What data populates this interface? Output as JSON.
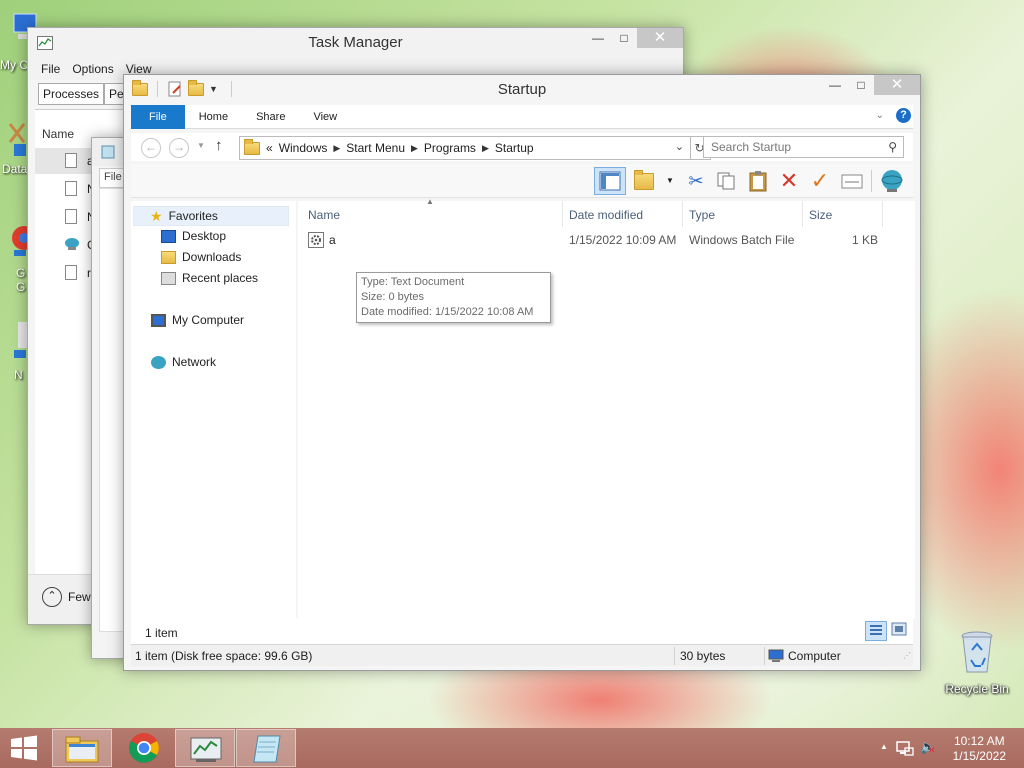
{
  "desktop": {
    "icons": [
      {
        "label": "My C",
        "name": "my-computer"
      },
      {
        "label": "Data",
        "name": "data"
      },
      {
        "label": "G\nG",
        "name": "google-chrome"
      },
      {
        "label": "N",
        "name": "network"
      },
      {
        "label": "Recycle Bin",
        "name": "recycle-bin"
      }
    ]
  },
  "taskmanager": {
    "title": "Task Manager",
    "menu": [
      "File",
      "Options",
      "View"
    ],
    "tabs": [
      "Processes",
      "Per"
    ],
    "column": "Name",
    "rows": [
      "a",
      "N",
      "N",
      "C",
      "r"
    ],
    "fewer_details": "Few"
  },
  "midwin": {
    "menu_file": "File"
  },
  "explorer": {
    "title": "Startup",
    "ribbon_tabs": [
      "File",
      "Home",
      "Share",
      "View"
    ],
    "address": {
      "prefix": "«",
      "crumbs": [
        "Windows",
        "Start Menu",
        "Programs",
        "Startup"
      ]
    },
    "search_placeholder": "Search Startup",
    "nav": {
      "favorites": "Favorites",
      "desktop": "Desktop",
      "downloads": "Downloads",
      "recent": "Recent places",
      "computer": "My Computer",
      "network": "Network"
    },
    "columns": {
      "name": "Name",
      "date": "Date modified",
      "type": "Type",
      "size": "Size"
    },
    "files": [
      {
        "name": "a",
        "date": "1/15/2022 10:09 AM",
        "type": "Windows Batch File",
        "size": "1 KB"
      }
    ],
    "tooltip": {
      "line1": "Type: Text Document",
      "line2": "Size: 0 bytes",
      "line3": "Date modified: 1/15/2022 10:08 AM"
    },
    "item_count": "1 item",
    "status": {
      "left": "1 item (Disk free space: 99.6 GB)",
      "middle": "30 bytes",
      "right": "Computer"
    }
  },
  "taskbar": {
    "apps": [
      "start",
      "file-explorer",
      "chrome",
      "task-manager",
      "notepad"
    ],
    "time": "10:12 AM",
    "date": "1/15/2022"
  }
}
